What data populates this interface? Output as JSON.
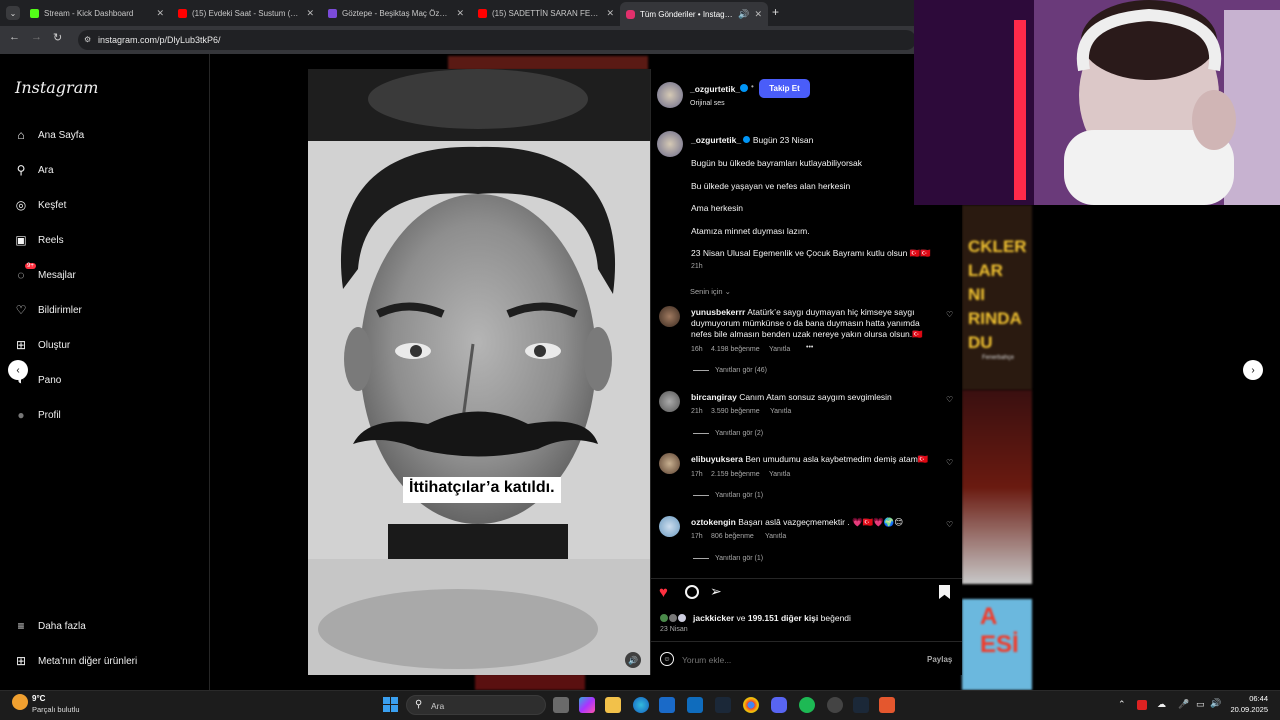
{
  "browser": {
    "tabs": [
      {
        "label": "Stream - Kick Dashboard",
        "color": "#53fc18"
      },
      {
        "label": "(15) Evdeki Saat - Sustum (Offi...",
        "color": "#ff0000"
      },
      {
        "label": "Göztepe - Beşiktaş Maç Özeti (...",
        "color": "#7b4bd9"
      },
      {
        "label": "(15) SADETTİN SARAN FENERB...",
        "color": "#ff0000"
      },
      {
        "label": "Tüm Gönderiler • Instagram",
        "color": "#e1306c"
      }
    ],
    "new_tab": "+",
    "url": "instagram.com/p/DlyLub3tkP6/"
  },
  "sidebar": {
    "logo": "Instagram",
    "items": [
      {
        "label": "Ana Sayfa",
        "icon": "home-icon",
        "glyph": "⌂"
      },
      {
        "label": "Ara",
        "icon": "search-icon",
        "glyph": "⚲"
      },
      {
        "label": "Keşfet",
        "icon": "compass-icon",
        "glyph": "◎"
      },
      {
        "label": "Reels",
        "icon": "reels-icon",
        "glyph": "▣"
      },
      {
        "label": "Mesajlar",
        "icon": "messenger-icon",
        "glyph": "◌",
        "badge": "9+"
      },
      {
        "label": "Bildirimler",
        "icon": "heart-icon",
        "glyph": "♡"
      },
      {
        "label": "Oluştur",
        "icon": "plus-square-icon",
        "glyph": "⊞"
      },
      {
        "label": "Pano",
        "icon": "dashboard-icon",
        "glyph": "◐"
      },
      {
        "label": "Profil",
        "icon": "profile-avatar-icon",
        "glyph": "●"
      }
    ],
    "more": "Daha fazla",
    "meta": "Meta'nın diğer ürünleri"
  },
  "post": {
    "image_caption": "İttihatçılar’a katıldı.",
    "author": "_ozgurtetik_",
    "dot": "•",
    "follow_label": "Takip Et",
    "audio": "Orijinal ses",
    "caption_lead": "Bugün 23 Nisan",
    "caption_lines": [
      "Bugün bu ülkede bayramları kutlayabiliyorsak",
      "Bu ülkede yaşayan ve nefes alan herkesin",
      "Ama herkesin",
      "Atamıza minnet duyması lazım.",
      "23 Nisan Ulusal Egemenlik ve Çocuk Bayramı kutlu olsun 🇹🇷🇹🇷"
    ],
    "caption_time": "21h",
    "sort_label": "Senin için",
    "likes_by": "jackkicker",
    "likes_others": "199.151 diğer kişi",
    "likes_connector": "ve",
    "likes_suffix": "beğendi",
    "date": "23 Nisan",
    "comment_placeholder": "Yorum ekle...",
    "share_label": "Paylaş"
  },
  "comments": [
    {
      "user": "yunusbekerrr",
      "text": "Atatürk’e saygı duymayan hiç kimseye saygı duymuyorum mümkünse o da bana duymasın hatta yanımda nefes bile almasın benden uzak nereye yakın olursa olsun.🇹🇷",
      "time": "16h",
      "likes": "4.198 beğenme",
      "reply": "Yanıtla",
      "more": "•••",
      "view_replies": "Yanıtları gör (46)"
    },
    {
      "user": "bircangiray",
      "text": "Canım Atam sonsuz saygım sevgimlesin",
      "time": "21h",
      "likes": "3.590 beğenme",
      "reply": "Yanıtla",
      "view_replies": "Yanıtları gör (2)"
    },
    {
      "user": "elibuyuksera",
      "text": "Ben umudumu asla kaybetmedim demiş atam🇹🇷",
      "time": "17h",
      "likes": "2.159 beğenme",
      "reply": "Yanıtla",
      "view_replies": "Yanıtları gör (1)"
    },
    {
      "user": "oztokengin",
      "text": "Başarı aslâ vazgeçmemektir . 💗🇹🇷💗🌍😊",
      "time": "17h",
      "likes": "806 beğenme",
      "reply": "Yanıtla",
      "view_replies": "Yanıtları gör (1)"
    }
  ],
  "taskbar": {
    "weather_temp": "9°C",
    "weather_desc": "Parçalı bulutlu",
    "search": "Ara",
    "time": "06:44",
    "date": "20.09.2025"
  },
  "background_text": {
    "poster": "CKLER\nLAR\nNI\nRINDA\nDU",
    "poster_sub": "Fenerbahçe",
    "ad": "A\nESİ"
  },
  "colors": {
    "accent": "#4a5df9",
    "like": "#ff3040",
    "verified": "#0095f6"
  }
}
